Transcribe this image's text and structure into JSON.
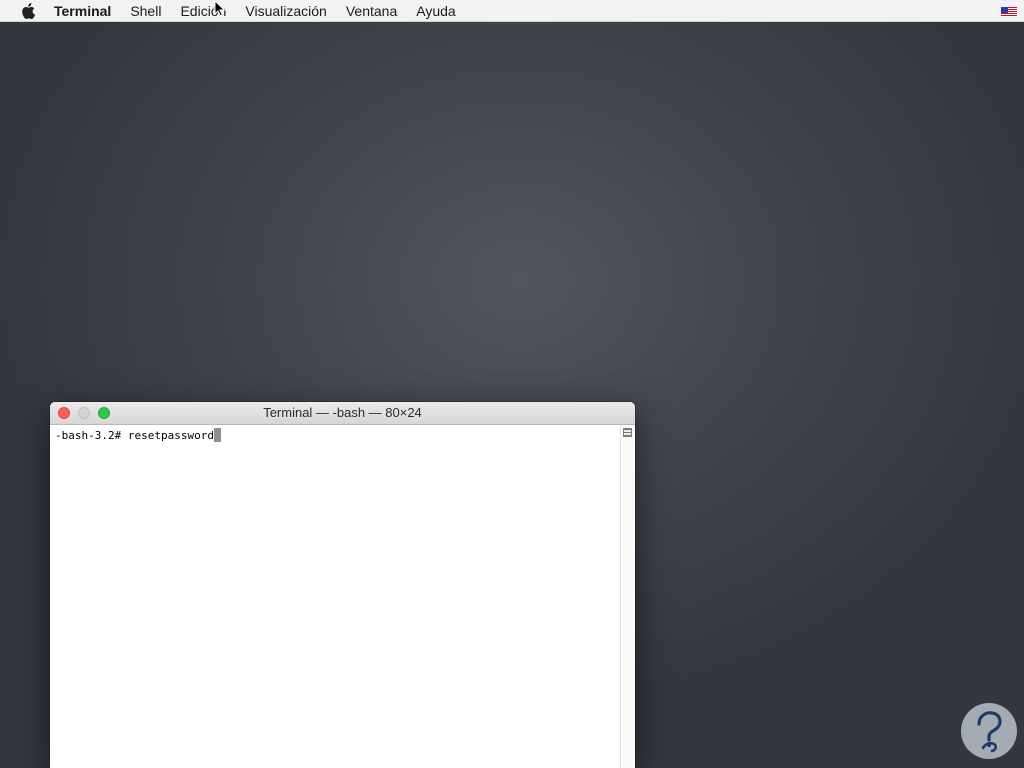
{
  "menubar": {
    "apple_icon": "apple-icon",
    "items": [
      "Terminal",
      "Shell",
      "Edición",
      "Visualización",
      "Ventana",
      "Ayuda"
    ],
    "input_source_icon": "us-flag-icon"
  },
  "window": {
    "title": "Terminal — -bash — 80×24",
    "controls": [
      "close-icon",
      "minimize-icon",
      "zoom-icon"
    ],
    "prompt": "-bash-3.2# ",
    "command": "resetpassword"
  },
  "watermark": {
    "icon": "solvetic-logo",
    "colors": {
      "circle": "#b9c0c8",
      "mark": "#1f3b66"
    }
  },
  "colors": {
    "desktop": "#43464e",
    "close": "#fc605c",
    "zoom": "#34c84a"
  }
}
